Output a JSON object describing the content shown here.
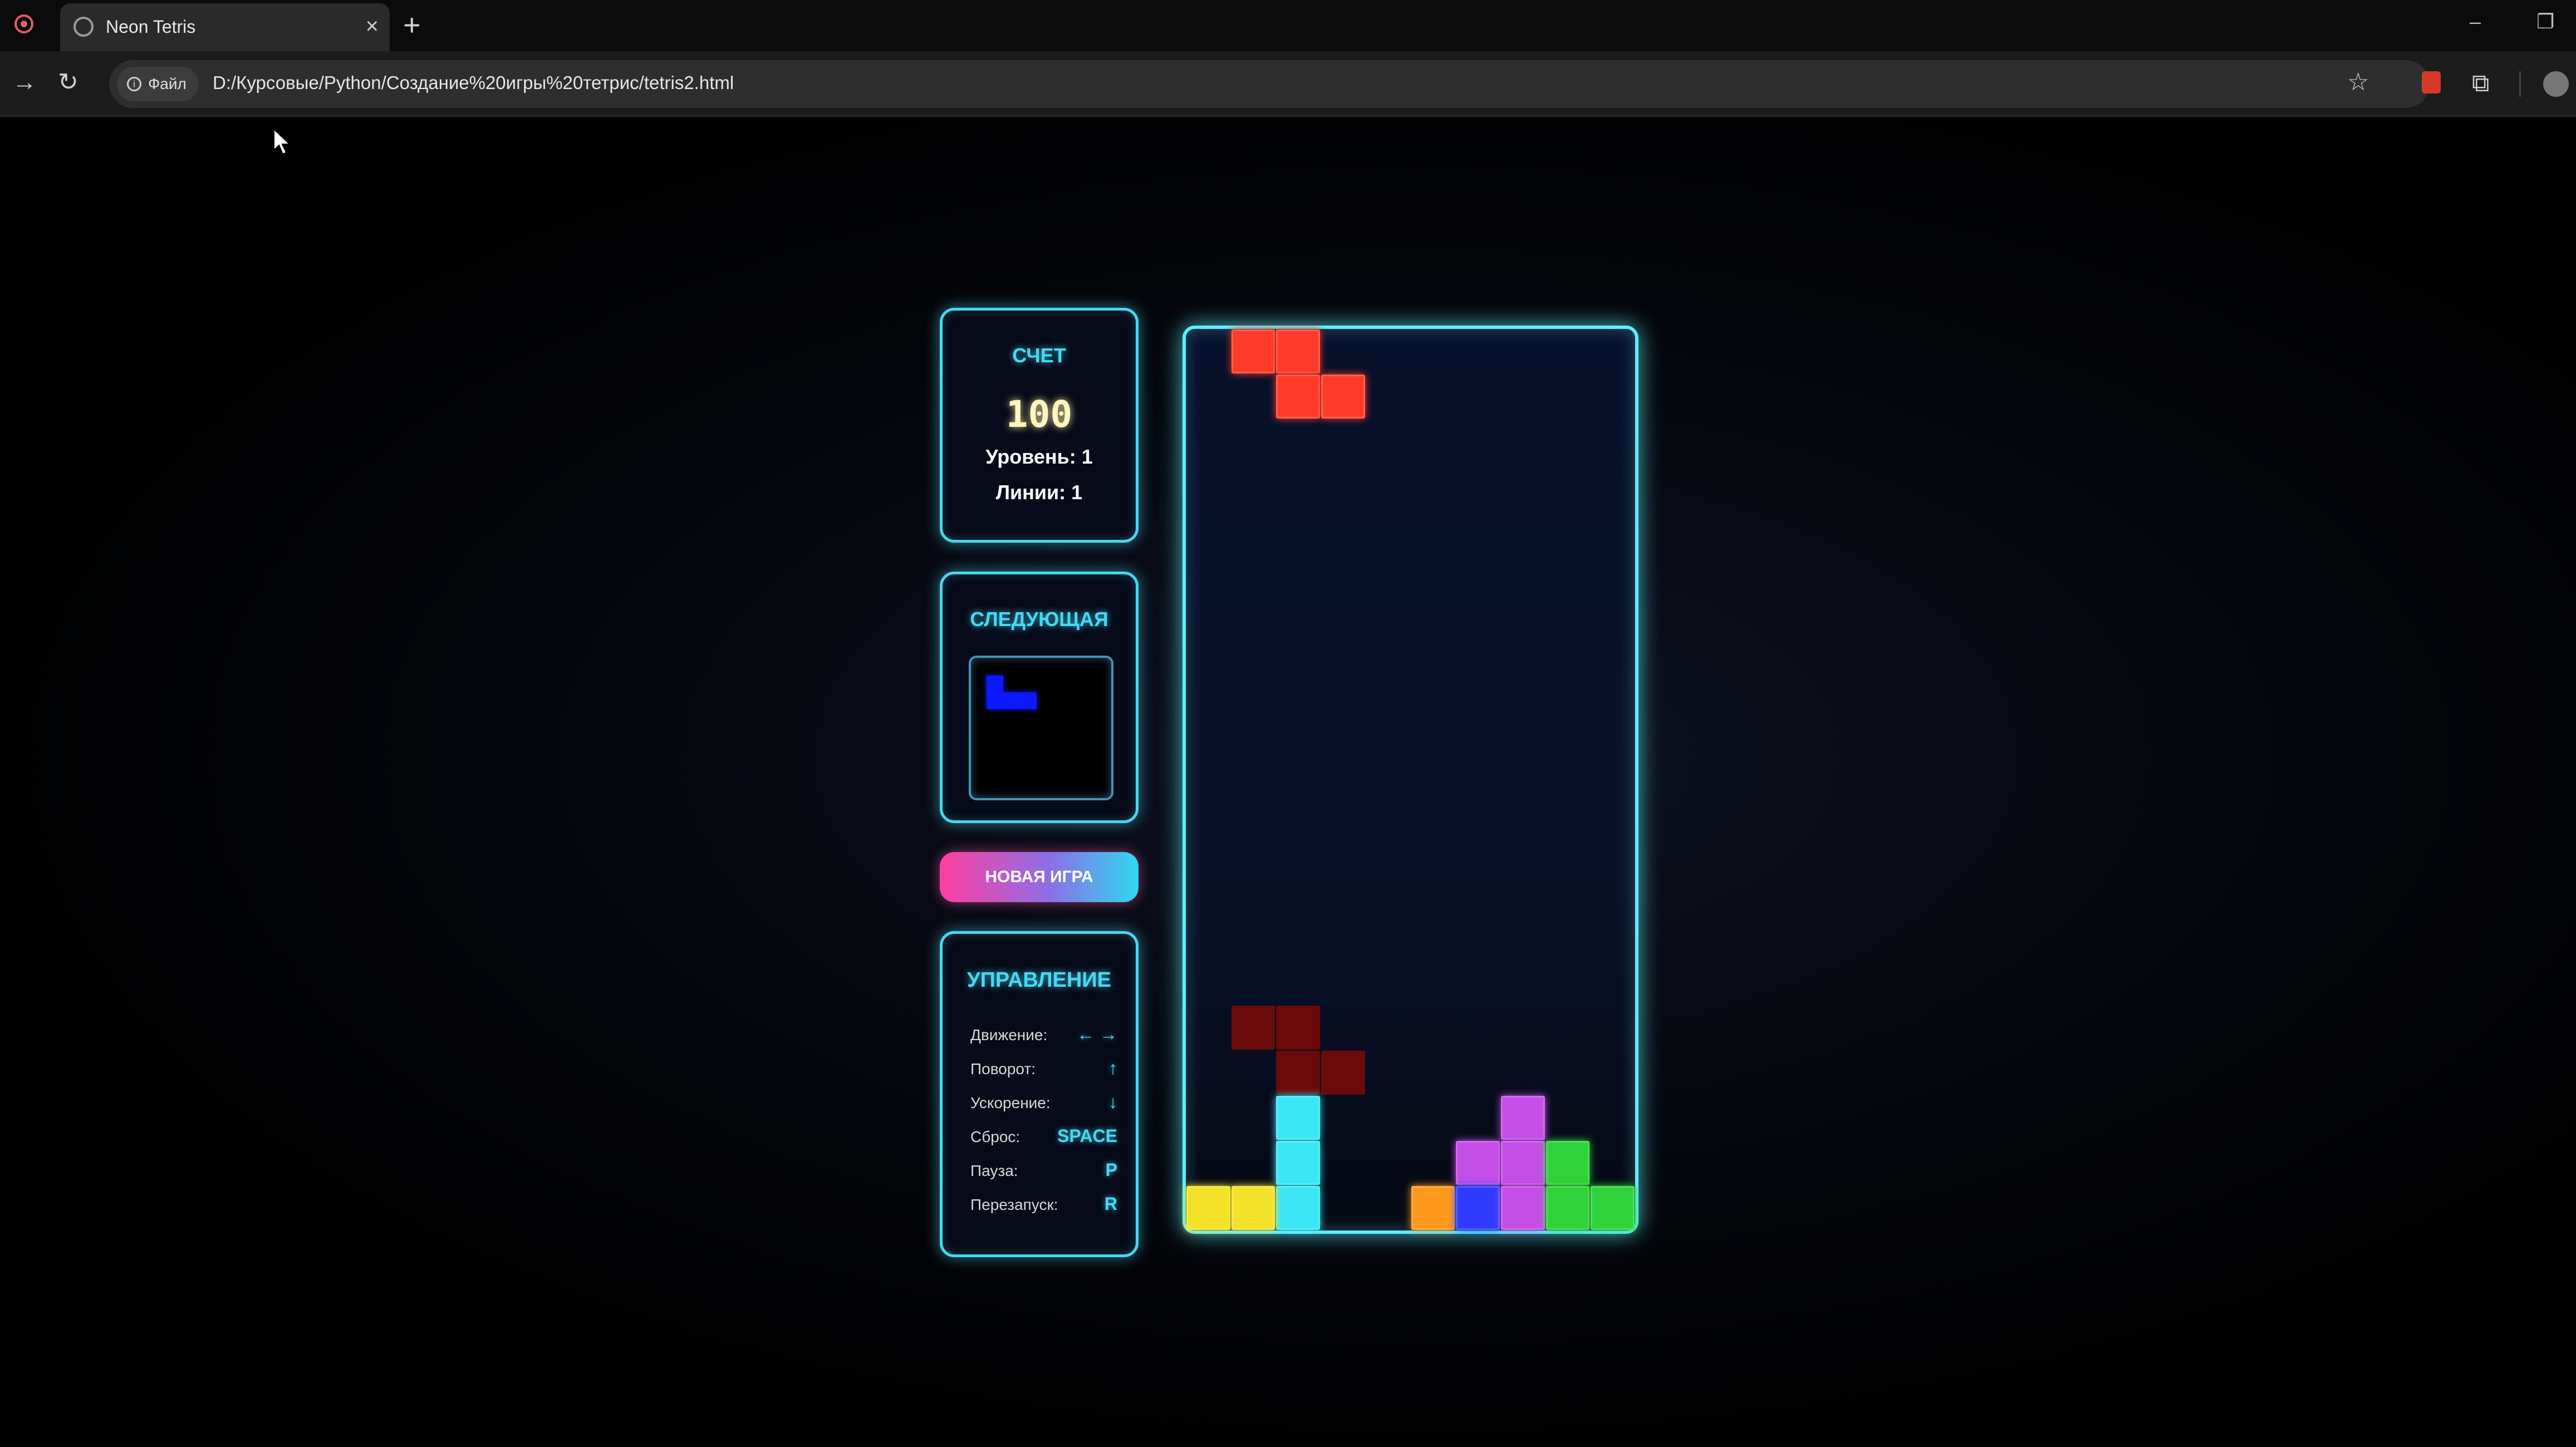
{
  "browser": {
    "tab_title": "Neon Tetris",
    "tab_close": "×",
    "new_tab": "+",
    "minimize": "–",
    "restore": "❐",
    "back_icon": "→",
    "reload_icon": "↻",
    "file_chip": "Файл",
    "url": "D:/Курсовые/Python/Создание%20игры%20тетрис/tetris2.html",
    "star_icon": "☆",
    "extensions_icon": "⧉"
  },
  "score_panel": {
    "title": "СЧЕТ",
    "score": "100",
    "level": "Уровень: 1",
    "lines": "Линии: 1"
  },
  "next_panel": {
    "title": "СЛЕДУЮЩАЯ"
  },
  "new_game_button": "НОВАЯ ИГРА",
  "controls_panel": {
    "title": "УПРАВЛЕНИЕ",
    "rows": [
      {
        "label": "Движение:",
        "key": "← →"
      },
      {
        "label": "Поворот:",
        "key": "↑"
      },
      {
        "label": "Ускорение:",
        "key": "↓"
      },
      {
        "label": "Сброс:",
        "key": "SPACE"
      },
      {
        "label": "Пауза:",
        "key": "P"
      },
      {
        "label": "Перезапуск:",
        "key": "R"
      }
    ]
  },
  "colors": {
    "neon_cyan": "#5cf0ff",
    "red": "#ff3b2a",
    "dark_red": "#6a0a0a",
    "cyan": "#3be7f5",
    "yellow": "#f4e22a",
    "orange": "#ff9a1f",
    "blue": "#2f3cff",
    "purple": "#c44fe6",
    "green": "#2fd23a",
    "next_blue": "#0c18ff"
  },
  "board": {
    "columns": 10,
    "rows": 20,
    "cells": [
      {
        "col": 1,
        "row": 0,
        "color": "red"
      },
      {
        "col": 2,
        "row": 0,
        "color": "red"
      },
      {
        "col": 2,
        "row": 1,
        "color": "red"
      },
      {
        "col": 3,
        "row": 1,
        "color": "red"
      },
      {
        "col": 1,
        "row": 15,
        "color": "dark_red"
      },
      {
        "col": 2,
        "row": 15,
        "color": "dark_red"
      },
      {
        "col": 2,
        "row": 16,
        "color": "dark_red"
      },
      {
        "col": 3,
        "row": 16,
        "color": "dark_red"
      },
      {
        "col": 2,
        "row": 17,
        "color": "cyan"
      },
      {
        "col": 2,
        "row": 18,
        "color": "cyan"
      },
      {
        "col": 2,
        "row": 19,
        "color": "cyan"
      },
      {
        "col": 0,
        "row": 19,
        "color": "yellow"
      },
      {
        "col": 1,
        "row": 19,
        "color": "yellow"
      },
      {
        "col": 7,
        "row": 17,
        "color": "purple"
      },
      {
        "col": 6,
        "row": 18,
        "color": "purple"
      },
      {
        "col": 7,
        "row": 18,
        "color": "purple"
      },
      {
        "col": 8,
        "row": 18,
        "color": "green"
      },
      {
        "col": 5,
        "row": 19,
        "color": "orange"
      },
      {
        "col": 6,
        "row": 19,
        "color": "blue"
      },
      {
        "col": 7,
        "row": 19,
        "color": "purple"
      },
      {
        "col": 8,
        "row": 19,
        "color": "green"
      },
      {
        "col": 9,
        "row": 19,
        "color": "green"
      }
    ]
  },
  "next_piece": {
    "color": "next_blue",
    "cells": [
      {
        "col": 0,
        "row": 0
      },
      {
        "col": 0,
        "row": 1
      },
      {
        "col": 1,
        "row": 1
      },
      {
        "col": 2,
        "row": 1
      }
    ]
  }
}
